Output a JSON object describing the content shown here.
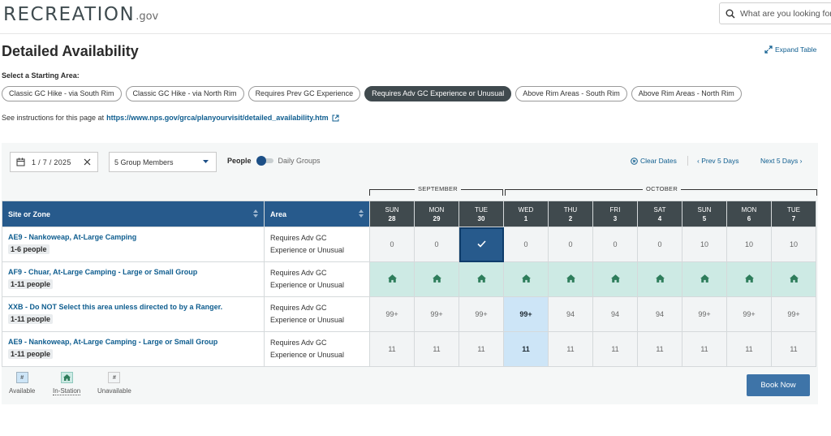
{
  "header": {
    "logo_main": "RECREATION",
    "logo_gov": ".gov",
    "search_placeholder": "What are you looking for?"
  },
  "page": {
    "title": "Detailed Availability",
    "expand_label": "Expand Table",
    "select_label": "Select a Starting Area:",
    "instructions_prefix": "See instructions for this page at",
    "instructions_link": "https://www.nps.gov/grca/planyourvisit/detailed_availability.htm"
  },
  "areas": [
    {
      "label": "Classic GC Hike - via South Rim",
      "active": false
    },
    {
      "label": "Classic GC Hike - via North Rim",
      "active": false
    },
    {
      "label": "Requires Prev GC Experience",
      "active": false
    },
    {
      "label": "Requires Adv GC Experience or Unusual",
      "active": true
    },
    {
      "label": "Above Rim Areas - South Rim",
      "active": false
    },
    {
      "label": "Above Rim Areas - North Rim",
      "active": false
    }
  ],
  "filters": {
    "date": "1 / 7 / 2025",
    "members": "5 Group Members",
    "toggle_left": "People",
    "toggle_right": "Daily Groups",
    "clear_dates": "Clear Dates",
    "prev": "Prev 5 Days",
    "next": "Next 5 Days"
  },
  "months": {
    "september": "SEPTEMBER",
    "october": "OCTOBER"
  },
  "table": {
    "col_site": "Site or Zone",
    "col_area": "Area",
    "days": [
      {
        "dow": "SUN",
        "num": "28"
      },
      {
        "dow": "MON",
        "num": "29"
      },
      {
        "dow": "TUE",
        "num": "30"
      },
      {
        "dow": "WED",
        "num": "1"
      },
      {
        "dow": "THU",
        "num": "2"
      },
      {
        "dow": "FRI",
        "num": "3"
      },
      {
        "dow": "SAT",
        "num": "4"
      },
      {
        "dow": "SUN",
        "num": "5"
      },
      {
        "dow": "MON",
        "num": "6"
      },
      {
        "dow": "TUE",
        "num": "7"
      }
    ],
    "rows": [
      {
        "site": "AE9 - Nankoweap, At-Large Camping",
        "people": "1-6 people",
        "area_line1": "Requires Adv GC",
        "area_line2": "Experience or Unusual",
        "cells": [
          "0",
          "0",
          "✓",
          "0",
          "0",
          "0",
          "0",
          "10",
          "10",
          "10"
        ],
        "states": [
          "",
          "",
          "selected",
          "",
          "",
          "",
          "",
          "",
          "",
          ""
        ]
      },
      {
        "site": "AF9 - Chuar, At-Large Camping - Large or Small Group",
        "people": "1-11 people",
        "area_line1": "Requires Adv GC",
        "area_line2": "Experience or Unusual",
        "cells": [
          "",
          "",
          "",
          "",
          "",
          "",
          "",
          "",
          "",
          ""
        ],
        "states": [
          "instation",
          "instation",
          "instation",
          "instation",
          "instation",
          "instation",
          "instation",
          "instation",
          "instation",
          "instation"
        ]
      },
      {
        "site": "XXB - Do NOT Select this area unless directed to by a Ranger.",
        "people": "1-11 people",
        "area_line1": "Requires Adv GC",
        "area_line2": "Experience or Unusual",
        "cells": [
          "99+",
          "99+",
          "99+",
          "99+",
          "94",
          "94",
          "94",
          "99+",
          "99+",
          "99+"
        ],
        "states": [
          "",
          "",
          "",
          "hl",
          "",
          "",
          "",
          "",
          "",
          ""
        ]
      },
      {
        "site": "AE9 - Nankoweap, At-Large Camping - Large or Small Group",
        "people": "1-11 people",
        "area_line1": "Requires Adv GC",
        "area_line2": "Experience or Unusual",
        "cells": [
          "11",
          "11",
          "11",
          "11",
          "11",
          "11",
          "11",
          "11",
          "11",
          "11"
        ],
        "states": [
          "",
          "",
          "",
          "hl",
          "",
          "",
          "",
          "",
          "",
          ""
        ]
      }
    ]
  },
  "legend": {
    "available_symbol": "#",
    "available": "Available",
    "instation": "In-Station",
    "unavailable_symbol": "#",
    "unavailable": "Unavailable"
  },
  "book_label": "Book Now",
  "colors": {
    "header_blue": "#275a8c",
    "header_dark": "#404a4e",
    "link": "#0e5d8f",
    "instation": "#cdeae4",
    "tent_icon": "#2e7d5b",
    "book_button": "#3e74a8"
  }
}
